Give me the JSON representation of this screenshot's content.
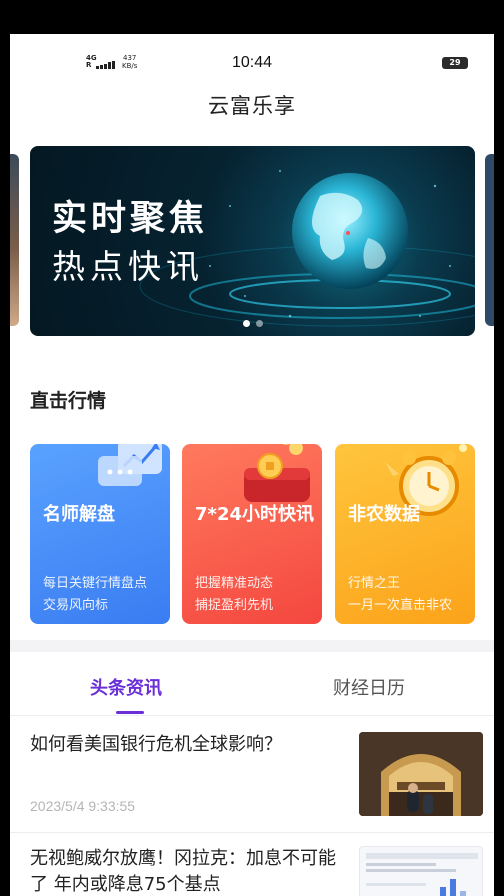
{
  "status_bar": {
    "network_type": "4G",
    "network_prefix": "R",
    "speed_value": "437",
    "speed_unit": "KB/s",
    "time": "10:44",
    "battery": "29"
  },
  "app": {
    "title": "云富乐享"
  },
  "banner": {
    "line1": "实时聚焦",
    "line2": "热点快讯",
    "slide_count": 2,
    "active_slide": 1
  },
  "market": {
    "section_title": "直击行情",
    "cards": [
      {
        "title": "名师解盘",
        "desc1": "每日关键行情盘点",
        "desc2": "交易风向标",
        "icon": "chat-chart-icon",
        "color": "#3a7cf2"
      },
      {
        "title": "7*24小时快讯",
        "desc1": "把握精准动态",
        "desc2": "捕捉盈利先机",
        "icon": "wallet-coin-icon",
        "color": "#f4473f"
      },
      {
        "title": "非农数据",
        "desc1": "行情之王",
        "desc2": "一月一次直击非农",
        "icon": "alarm-clock-icon",
        "color": "#fba31a"
      }
    ]
  },
  "tabs": [
    {
      "label": "头条资讯",
      "active": true
    },
    {
      "label": "财经日历",
      "active": false
    }
  ],
  "accent_color": "#6a2fd6",
  "news": [
    {
      "title": "如何看美国银行危机全球影响？",
      "date": "2023/5/4 9:33:55",
      "thumb": "bank-building-photo"
    },
    {
      "title": "无视鲍威尔放鹰！冈拉克：加息不可能了 年内或降息75个基点",
      "thumb": "chart-screenshot"
    }
  ]
}
